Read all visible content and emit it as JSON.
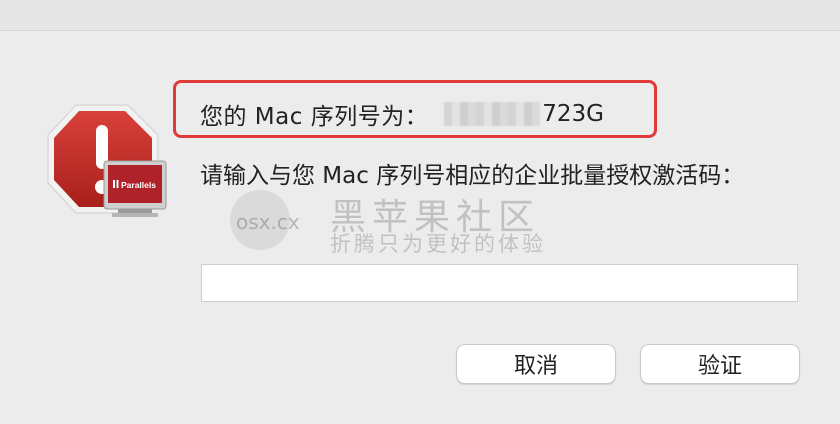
{
  "dialog": {
    "serial_label": "您的 Mac 序列号为：",
    "serial_suffix": "723G",
    "prompt": "请输入与您 Mac 序列号相应的企业批量授权激活码：",
    "activation_code_value": "",
    "cancel_label": "取消",
    "verify_label": "验证",
    "highlight_color": "#e03a3a"
  },
  "icon": {
    "alert": "stop-sign-exclamation-icon",
    "brand": "Parallels"
  },
  "watermark": {
    "title": "黑苹果社区",
    "subtitle": "折腾只为更好的体验",
    "url": "osx.cx"
  }
}
